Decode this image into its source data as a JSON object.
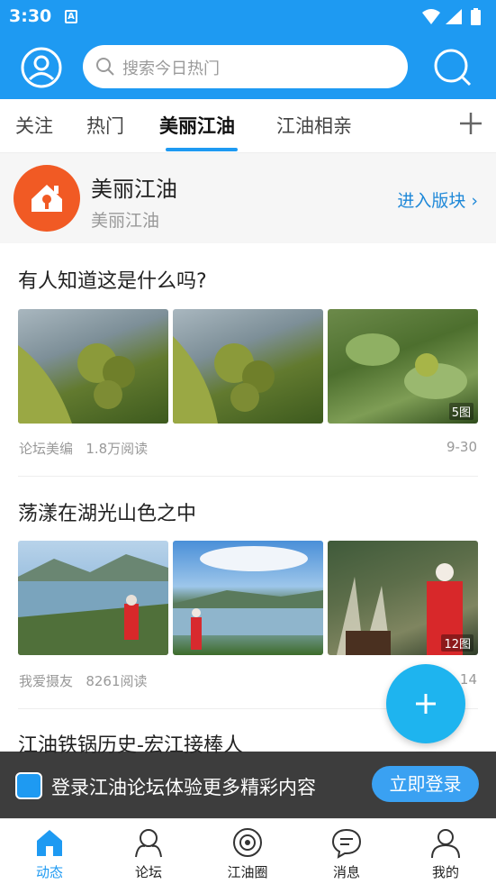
{
  "status_bar": {
    "time": "3:30",
    "notif_letter": "A"
  },
  "search": {
    "placeholder": "搜索今日热门"
  },
  "tabs": [
    {
      "label": "关注",
      "active": false
    },
    {
      "label": "热门",
      "active": false
    },
    {
      "label": "美丽江油",
      "active": true
    },
    {
      "label": "江油相亲",
      "active": false
    }
  ],
  "forum": {
    "title": "美丽江油",
    "subtitle": "美丽江油",
    "enter_label": "进入版块 ›"
  },
  "posts": [
    {
      "title": "有人知道这是什么吗?",
      "image_count": "5图",
      "author": "论坛美编",
      "views": "1.8万阅读",
      "date": "9-30"
    },
    {
      "title": "荡漾在湖光山色之中",
      "image_count": "12图",
      "author": "我爱摄友",
      "views": "8261阅读",
      "date": "14"
    },
    {
      "title": "江油铁锅历史-宏江接棒人"
    }
  ],
  "login_banner": {
    "text": "登录江油论坛体验更多精彩内容",
    "button": "立即登录"
  },
  "fab_label": "+",
  "bottom_nav": [
    {
      "label": "动态",
      "icon": "home-icon",
      "active": true
    },
    {
      "label": "论坛",
      "icon": "forum-icon",
      "active": false
    },
    {
      "label": "江油圈",
      "icon": "circle-icon",
      "active": false
    },
    {
      "label": "消息",
      "icon": "message-icon",
      "active": false
    },
    {
      "label": "我的",
      "icon": "profile-icon",
      "active": false
    }
  ],
  "colors": {
    "primary": "#1e9af2",
    "forum_logo": "#f15a24",
    "fab": "#1eb4ef"
  }
}
